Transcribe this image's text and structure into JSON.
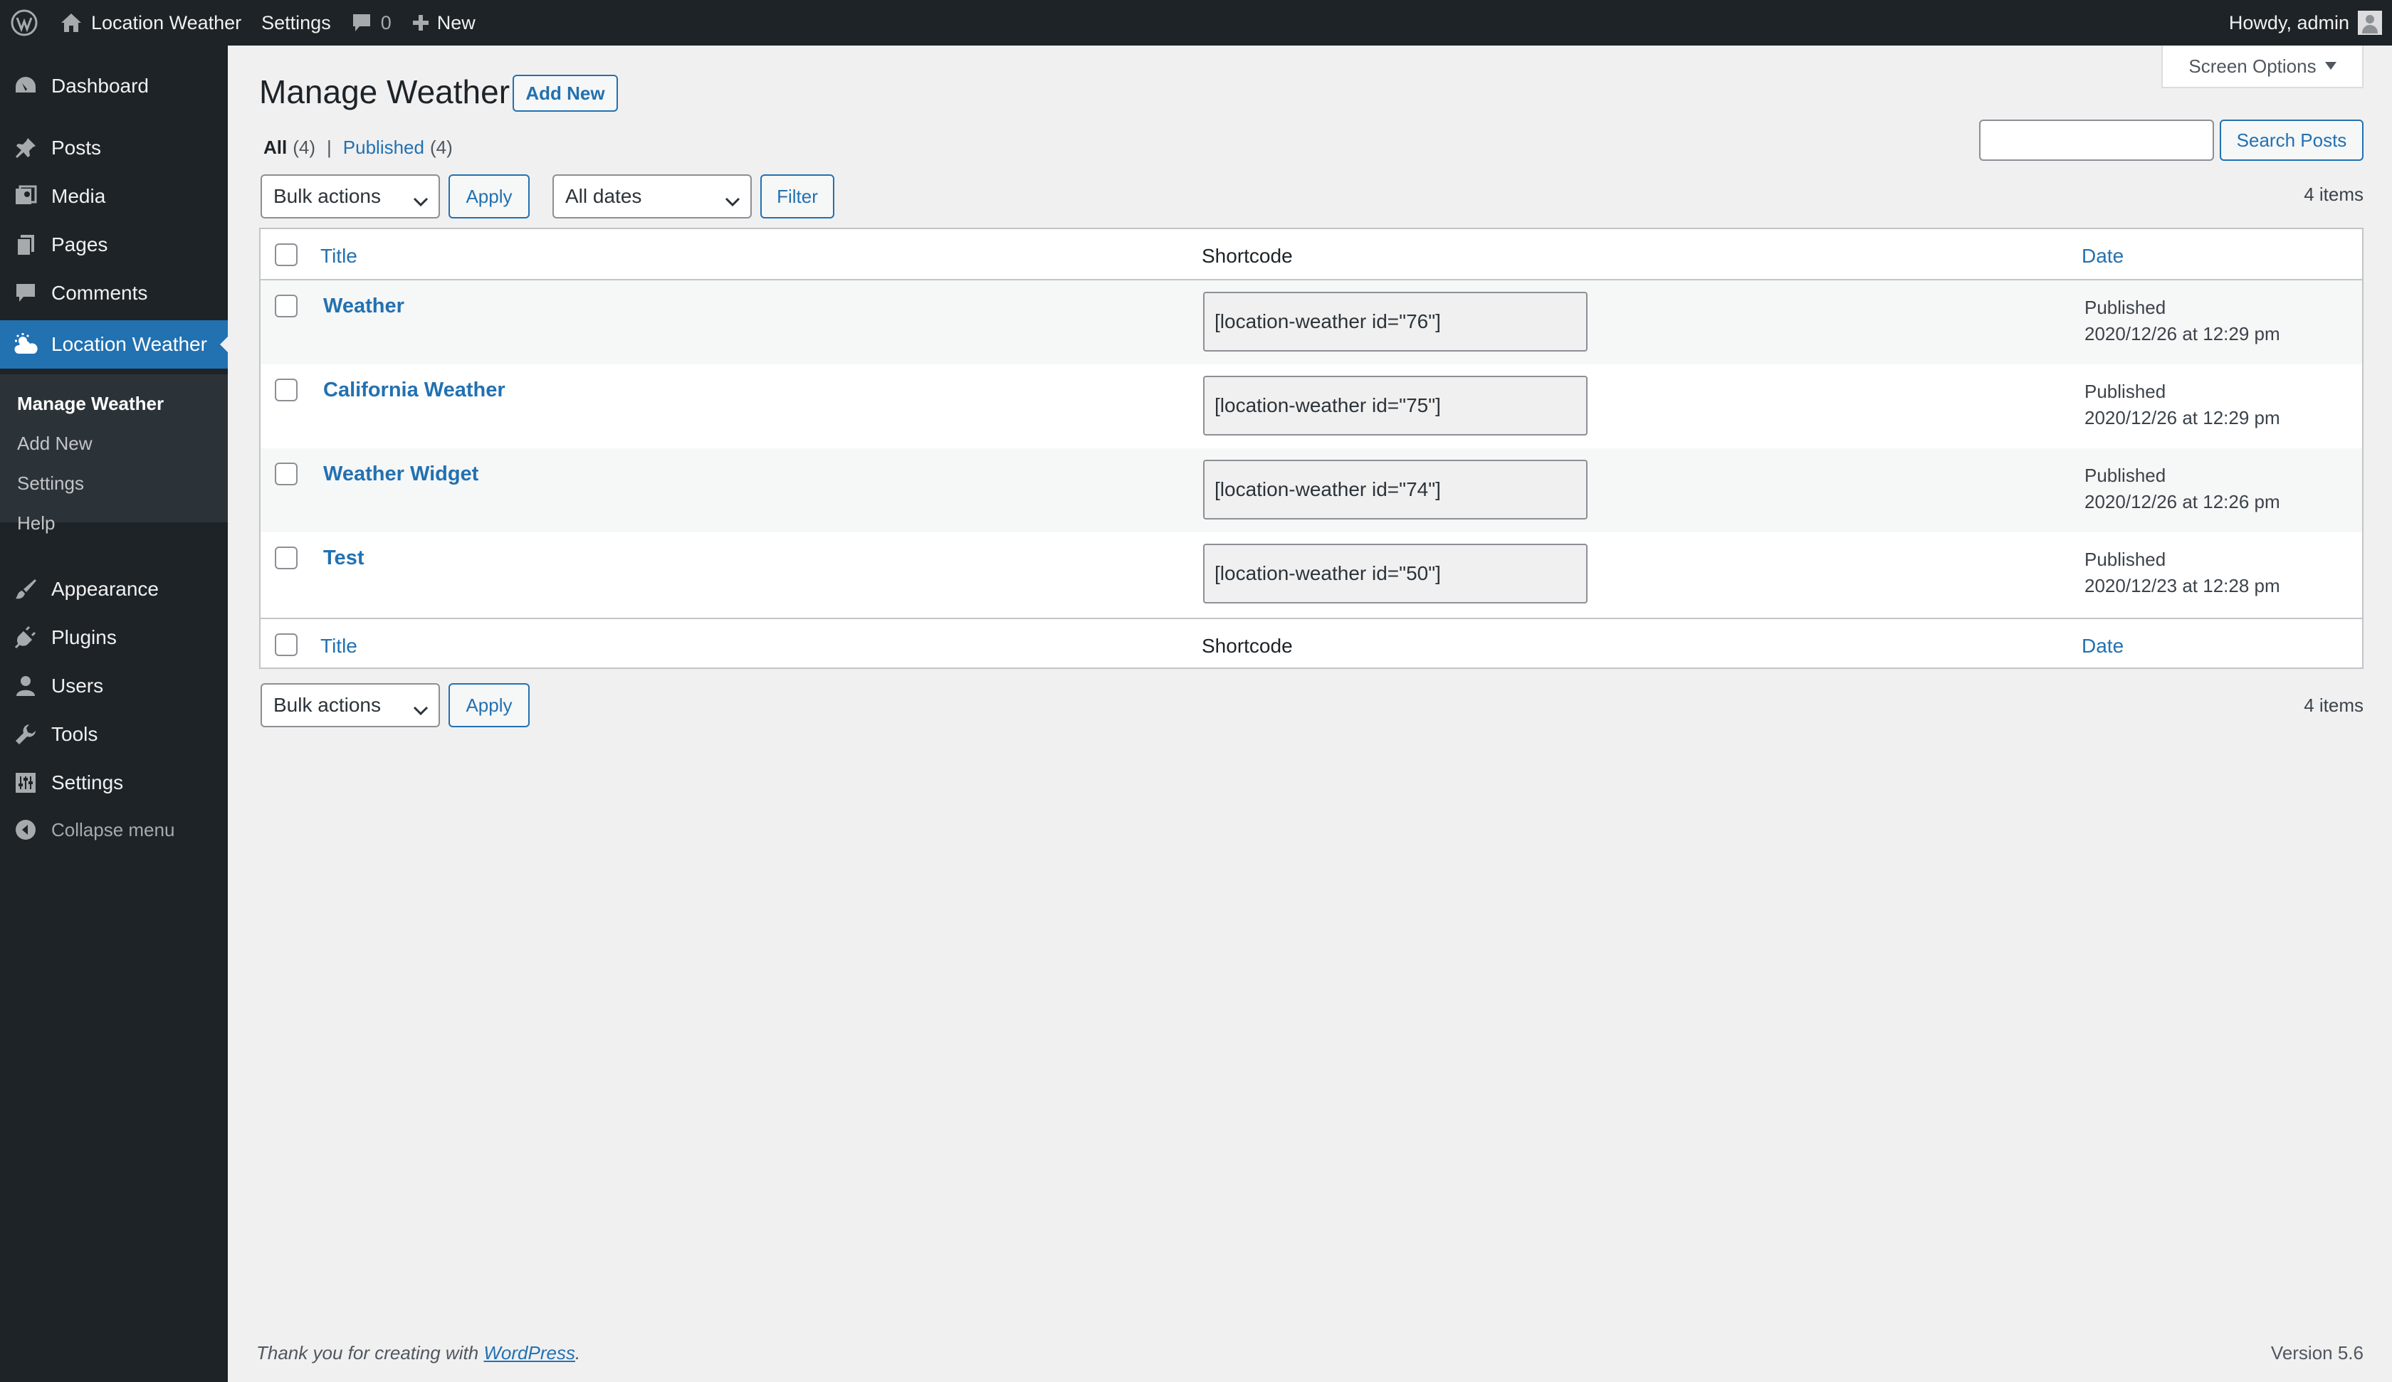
{
  "adminbar": {
    "site_name": "Location Weather",
    "settings": "Settings",
    "comments_count": "0",
    "new_label": "New",
    "howdy": "Howdy, admin"
  },
  "sidebar": {
    "dashboard": "Dashboard",
    "posts": "Posts",
    "media": "Media",
    "pages": "Pages",
    "comments": "Comments",
    "location_weather": "Location Weather",
    "submenu": [
      "Manage Weather",
      "Add New",
      "Settings",
      "Help"
    ],
    "appearance": "Appearance",
    "plugins": "Plugins",
    "users": "Users",
    "tools": "Tools",
    "settings": "Settings",
    "collapse": "Collapse menu"
  },
  "page": {
    "title": "Manage Weather",
    "add_new": "Add New",
    "screen_options": "Screen Options",
    "filter_all": "All",
    "filter_all_count": "(4)",
    "filter_separator": "|",
    "filter_published": "Published",
    "filter_published_count": "(4)",
    "search_button": "Search Posts",
    "search_value": "",
    "bulk_actions": "Bulk actions",
    "apply": "Apply",
    "all_dates": "All dates",
    "filter": "Filter",
    "items_count": "4 items"
  },
  "table": {
    "columns": {
      "title": "Title",
      "shortcode": "Shortcode",
      "date": "Date"
    },
    "rows": [
      {
        "title": "Weather",
        "shortcode": "[location-weather id=\"76\"]",
        "status": "Published",
        "date": "2020/12/26 at 12:29 pm"
      },
      {
        "title": "California Weather",
        "shortcode": "[location-weather id=\"75\"]",
        "status": "Published",
        "date": "2020/12/26 at 12:29 pm"
      },
      {
        "title": "Weather Widget",
        "shortcode": "[location-weather id=\"74\"]",
        "status": "Published",
        "date": "2020/12/26 at 12:26 pm"
      },
      {
        "title": "Test",
        "shortcode": "[location-weather id=\"50\"]",
        "status": "Published",
        "date": "2020/12/23 at 12:28 pm"
      }
    ]
  },
  "footer": {
    "thanks_prefix": "Thank you for creating with ",
    "thanks_link": "WordPress",
    "thanks_suffix": ".",
    "version": "Version 5.6"
  },
  "colors": {
    "accent": "#2271b1",
    "sidebar_bg": "#1d2327",
    "submenu_bg": "#2c3338",
    "page_bg": "#f0f0f1"
  }
}
